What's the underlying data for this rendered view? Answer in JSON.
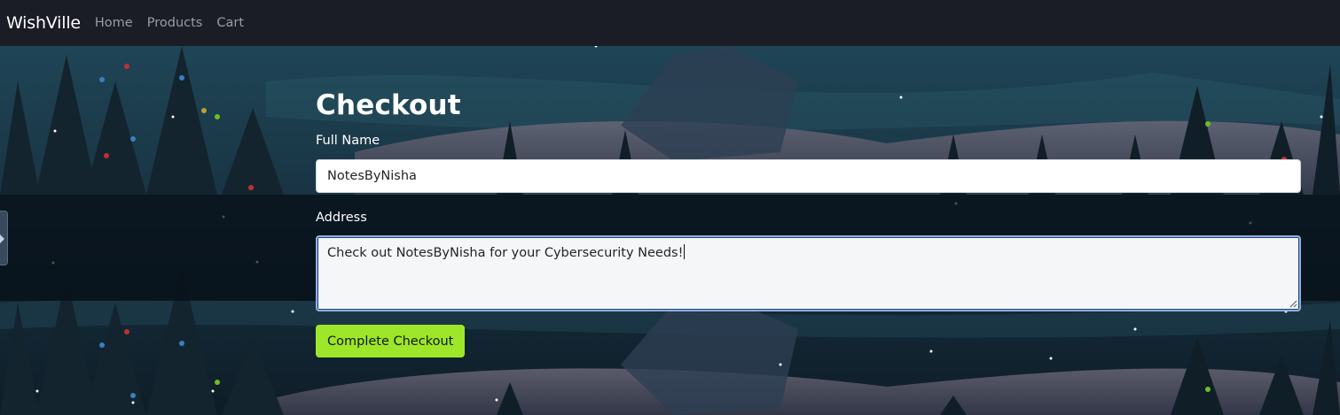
{
  "navbar": {
    "brand": "WishVille",
    "links": [
      {
        "label": "Home"
      },
      {
        "label": "Products"
      },
      {
        "label": "Cart"
      }
    ]
  },
  "checkout": {
    "title": "Checkout",
    "full_name": {
      "label": "Full Name",
      "value": "NotesByNisha"
    },
    "address": {
      "label": "Address",
      "value": "Check out NotesByNisha for your Cybersecurity Needs!"
    },
    "submit_label": "Complete Checkout"
  },
  "colors": {
    "navbar_bg": "#1a1c26",
    "accent_button": "#9ee62a",
    "scene_sky": "#1d3a4a"
  },
  "background": {
    "icon": "winter-forest-background"
  }
}
